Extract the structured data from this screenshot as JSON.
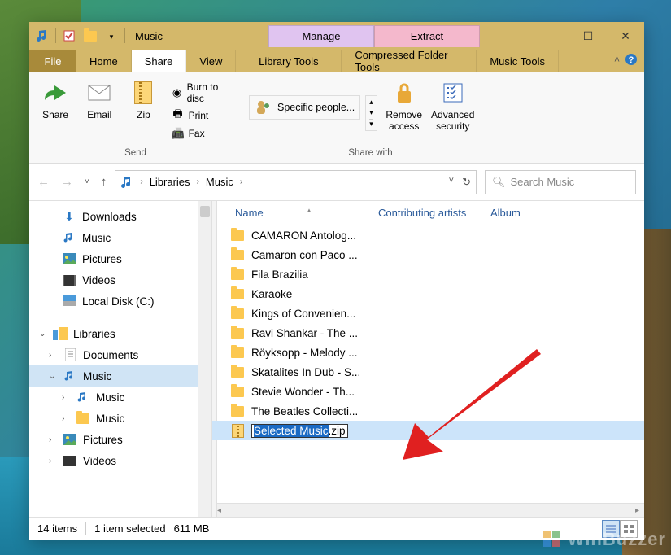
{
  "title": "Music",
  "context_tabs": {
    "manage": "Manage",
    "extract": "Extract"
  },
  "tabs": {
    "file": "File",
    "home": "Home",
    "share": "Share",
    "view": "View",
    "library": "Library Tools",
    "compressed": "Compressed Folder Tools",
    "music": "Music Tools"
  },
  "ribbon": {
    "send": {
      "label": "Send",
      "share": "Share",
      "email": "Email",
      "zip": "Zip",
      "burn": "Burn to disc",
      "print": "Print",
      "fax": "Fax"
    },
    "sharewith": {
      "label": "Share with",
      "specific": "Specific people...",
      "remove": "Remove access",
      "advanced": "Advanced security"
    }
  },
  "breadcrumb": {
    "libraries": "Libraries",
    "music": "Music"
  },
  "search": {
    "placeholder": "Search Music"
  },
  "tree": {
    "downloads": "Downloads",
    "music": "Music",
    "pictures": "Pictures",
    "videos": "Videos",
    "localdisk": "Local Disk (C:)",
    "libraries": "Libraries",
    "documents": "Documents",
    "picturesL": "Pictures",
    "videosL": "Videos"
  },
  "columns": {
    "name": "Name",
    "artists": "Contributing artists",
    "album": "Album"
  },
  "files": [
    "CAMARON Antolog...",
    "Camaron con Paco ...",
    "Fila Brazilia",
    "Karaoke",
    "Kings of Convenien...",
    "Ravi Shankar - The ...",
    "Röyksopp - Melody ...",
    "Skatalites In Dub - S...",
    "Stevie Wonder - Th...",
    "The Beatles Collecti..."
  ],
  "rename": {
    "selected": "Selected Music",
    "ext": ".zip"
  },
  "status": {
    "items": "14 items",
    "selected": "1 item selected",
    "size": "611 MB"
  },
  "watermark": "WinBuzzer"
}
